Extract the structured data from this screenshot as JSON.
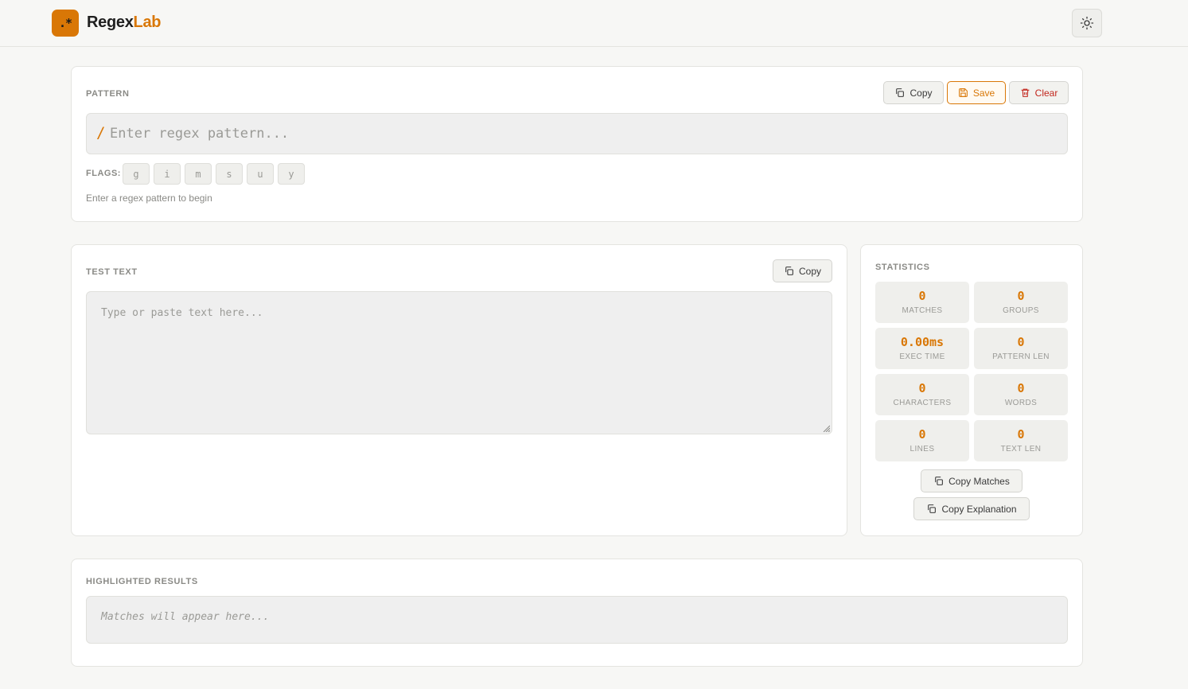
{
  "header": {
    "logo_text": ".*",
    "brand_part1": "Regex",
    "brand_part2": "Lab",
    "theme_toggle_icon": "sun-icon"
  },
  "pattern": {
    "label": "PATTERN",
    "copy_label": "Copy",
    "save_label": "Save",
    "clear_label": "Clear",
    "delimiter": "/",
    "placeholder": "Enter regex pattern...",
    "flags_label": "FLAGS:",
    "flags": [
      "g",
      "i",
      "m",
      "s",
      "u",
      "y"
    ],
    "hint": "Enter a regex pattern to begin"
  },
  "test": {
    "label": "TEST TEXT",
    "copy_label": "Copy",
    "placeholder": "Type or paste text here..."
  },
  "statistics": {
    "label": "STATISTICS",
    "items": [
      {
        "value": "0",
        "label": "MATCHES"
      },
      {
        "value": "0",
        "label": "GROUPS"
      },
      {
        "value": "0.00ms",
        "label": "EXEC TIME"
      },
      {
        "value": "0",
        "label": "PATTERN LEN"
      },
      {
        "value": "0",
        "label": "CHARACTERS"
      },
      {
        "value": "0",
        "label": "WORDS"
      },
      {
        "value": "0",
        "label": "LINES"
      },
      {
        "value": "0",
        "label": "TEXT LEN"
      }
    ],
    "copy_matches_label": "Copy Matches",
    "copy_explanation_label": "Copy Explanation"
  },
  "results": {
    "label": "HIGHLIGHTED RESULTS",
    "placeholder": "Matches will appear here..."
  },
  "colors": {
    "accent": "#d97706",
    "danger": "#c2261d"
  }
}
